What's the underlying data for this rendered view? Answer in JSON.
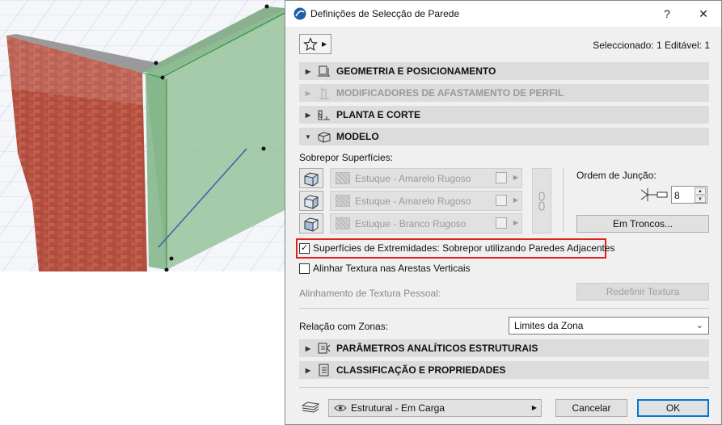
{
  "dialog": {
    "title": "Definições de Selecção de Parede",
    "help_label": "?",
    "close_label": "✕",
    "selected_info": "Seleccionado: 1 Editável: 1"
  },
  "sections": {
    "geometry": "GEOMETRIA E POSICIONAMENTO",
    "profile_modifiers": "MODIFICADORES DE AFASTAMENTO DE PERFIL",
    "floor_plan": "PLANTA E CORTE",
    "model": "MODELO",
    "structural": "PARÂMETROS ANALÍTICOS ESTRUTURAIS",
    "classification": "CLASSIFICAÇÃO E PROPRIEDADES"
  },
  "model": {
    "override_label": "Sobrepor Superfícies:",
    "surfaces": [
      "Estuque - Amarelo Rugoso",
      "Estuque - Amarelo Rugoso",
      "Estuque - Branco Rugoso"
    ],
    "junction_order_label": "Ordem de Junção:",
    "junction_order_value": "8",
    "log_details_button": "Em Troncos...",
    "end_surfaces_checkbox": "Superfícies de Extremidades: Sobrepor utilizando Paredes Adjacentes",
    "end_surfaces_checked": true,
    "align_texture_checkbox": "Alinhar Textura nas Arestas Verticais",
    "align_texture_checked": false,
    "custom_texture_label": "Alinhamento de Textura Pessoal:",
    "reset_texture_button": "Redefinir Textura"
  },
  "zones": {
    "label": "Relação com Zonas:",
    "value": "Limites da Zona"
  },
  "footer": {
    "layer_value": "Estrutural - Em Carga",
    "cancel_label": "Cancelar",
    "ok_label": "OK"
  },
  "colors": {
    "brick": "#b34a3c",
    "selection_green": "#86b88e",
    "highlight_red": "#e02020",
    "accent_blue": "#0078d7"
  }
}
